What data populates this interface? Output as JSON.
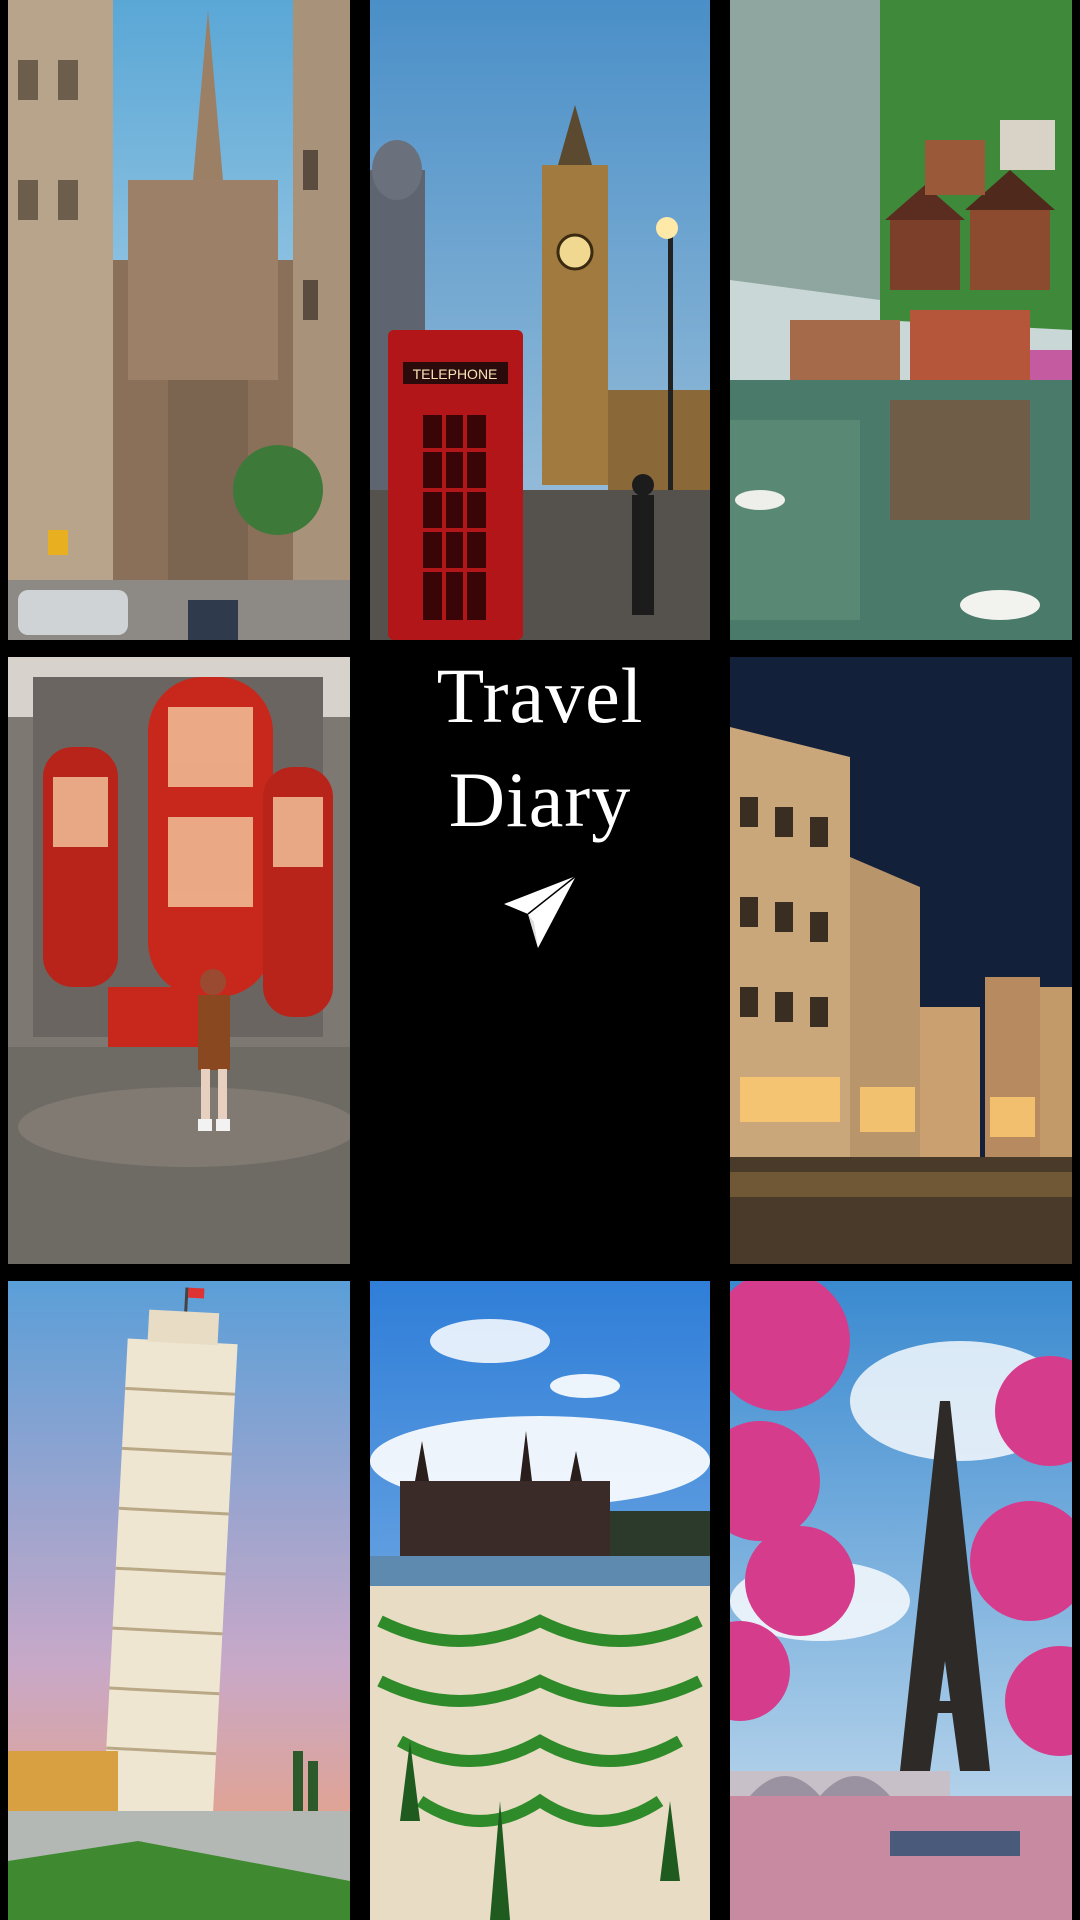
{
  "collage": {
    "title_line1": "Travel",
    "title_line2": "Diary",
    "icon": "paper-plane-icon",
    "booth_sign": "TELEPHONE"
  }
}
